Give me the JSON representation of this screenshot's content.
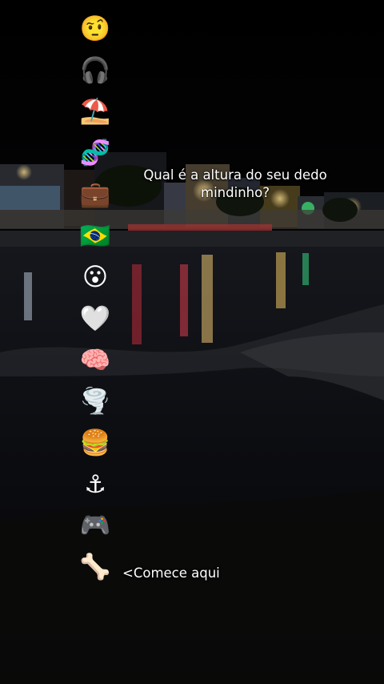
{
  "question": "Qual é a altura do seu dedo mindinho?",
  "start_label": "<Comece aqui",
  "emojis": [
    {
      "glyph": "🤨",
      "icon": "raised-eyebrow-face-icon"
    },
    {
      "glyph": "🎧",
      "icon": "headphones-icon"
    },
    {
      "glyph": "⛱️",
      "icon": "beach-umbrella-icon"
    },
    {
      "glyph": "🧬",
      "icon": "dna-icon"
    },
    {
      "glyph": "💼",
      "icon": "briefcase-icon"
    },
    {
      "glyph": "🇧🇷",
      "icon": "brazil-flag-icon"
    },
    {
      "glyph": "😮",
      "icon": "surprised-face-icon"
    },
    {
      "glyph": "🤍",
      "icon": "white-heart-icon"
    },
    {
      "glyph": "🧠",
      "icon": "brain-icon"
    },
    {
      "glyph": "🌪️",
      "icon": "tornado-icon"
    },
    {
      "glyph": "🍔",
      "icon": "hamburger-icon"
    },
    {
      "glyph": "⚓",
      "icon": "anchor-icon"
    },
    {
      "glyph": "🎮",
      "icon": "game-controller-icon"
    },
    {
      "glyph": "🦴",
      "icon": "bone-icon"
    }
  ],
  "colors": {
    "caption": "#ffffff",
    "water": "#0d0f14",
    "lights": "#e2c06a"
  }
}
